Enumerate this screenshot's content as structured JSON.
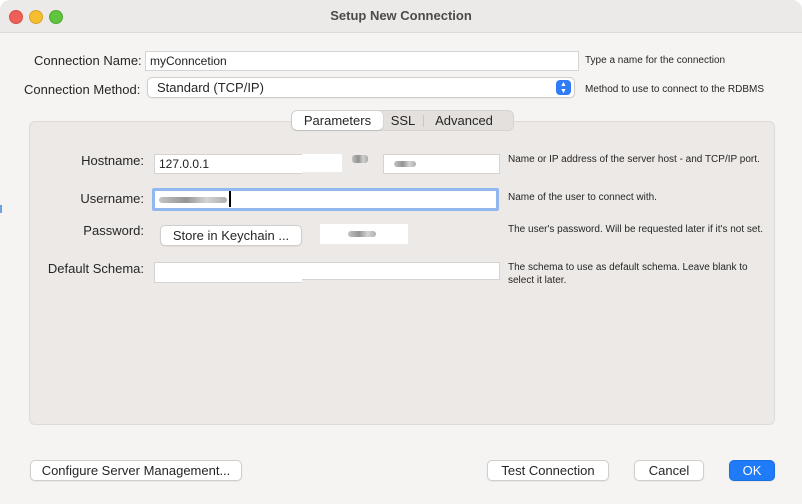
{
  "window": {
    "title": "Setup New Connection"
  },
  "connection_name": {
    "label": "Connection Name:",
    "value": "myConncetion",
    "hint": "Type a name for the connection"
  },
  "connection_method": {
    "label": "Connection Method:",
    "value": "Standard (TCP/IP)",
    "hint": "Method to use to connect to the RDBMS"
  },
  "tabs": [
    {
      "label": "Parameters",
      "active": true
    },
    {
      "label": "SSL",
      "active": false
    },
    {
      "label": "Advanced",
      "active": false
    }
  ],
  "parameters": {
    "hostname": {
      "label": "Hostname:",
      "value": "127.0.0.1",
      "hint": "Name or IP address of the server host - and TCP/IP port."
    },
    "username": {
      "label": "Username:",
      "hint": "Name of the user to connect with."
    },
    "password": {
      "label": "Password:",
      "button": "Store in Keychain ...",
      "hint": "The user's password. Will be requested later if it's not set."
    },
    "default_schema": {
      "label": "Default Schema:",
      "value": "",
      "hint": "The schema to use as default schema. Leave blank to select it later."
    }
  },
  "footer": {
    "configure_label": "Configure Server Management...",
    "test_label": "Test Connection",
    "cancel_label": "Cancel",
    "ok_label": "OK"
  },
  "colors": {
    "accent": "#1f7bf7",
    "focus_ring": "#93b8ef",
    "close": "#ee5f57",
    "minimize": "#f6be2f",
    "zoom": "#5fc53f"
  }
}
